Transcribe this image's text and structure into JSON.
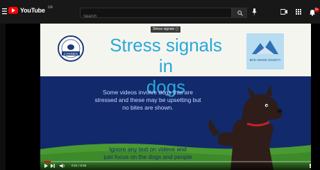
{
  "header": {
    "logo_text": "YouTube",
    "region_code": "GB",
    "search_placeholder": "Search",
    "notification_count": "9+"
  },
  "icons": {
    "menu": "hamburger-menu-icon",
    "search": "search-icon",
    "mic": "microphone-icon",
    "create": "create-video-icon",
    "apps": "apps-grid-icon",
    "notifications": "bell-icon"
  },
  "video": {
    "overlay_chip": "Stress signals",
    "slide_title_line1": "Stress signals in",
    "slide_title_line2": "dogs",
    "body_text_1_line1": "Some videos involve dogs that are",
    "body_text_1_line2": "stressed and these may be upsetting but",
    "body_text_1_line3": "no bites are shown.",
    "body_text_2_line1": "Ignore any text on videos and",
    "body_text_2_line2": "just focus on the dogs and people",
    "left_logo_caption": "CANINES",
    "right_logo_caption": "BITE AWARE SOCIETY",
    "progress": 0.02,
    "time_display": "0:01 / 5:56"
  },
  "colors": {
    "topbar_bg": "#181818",
    "yt_red": "#ff0000",
    "slide_white": "#f5f5f0",
    "slide_blue": "#12296b",
    "title_cyan": "#28a8d8",
    "grass_green": "#4a9a32"
  }
}
